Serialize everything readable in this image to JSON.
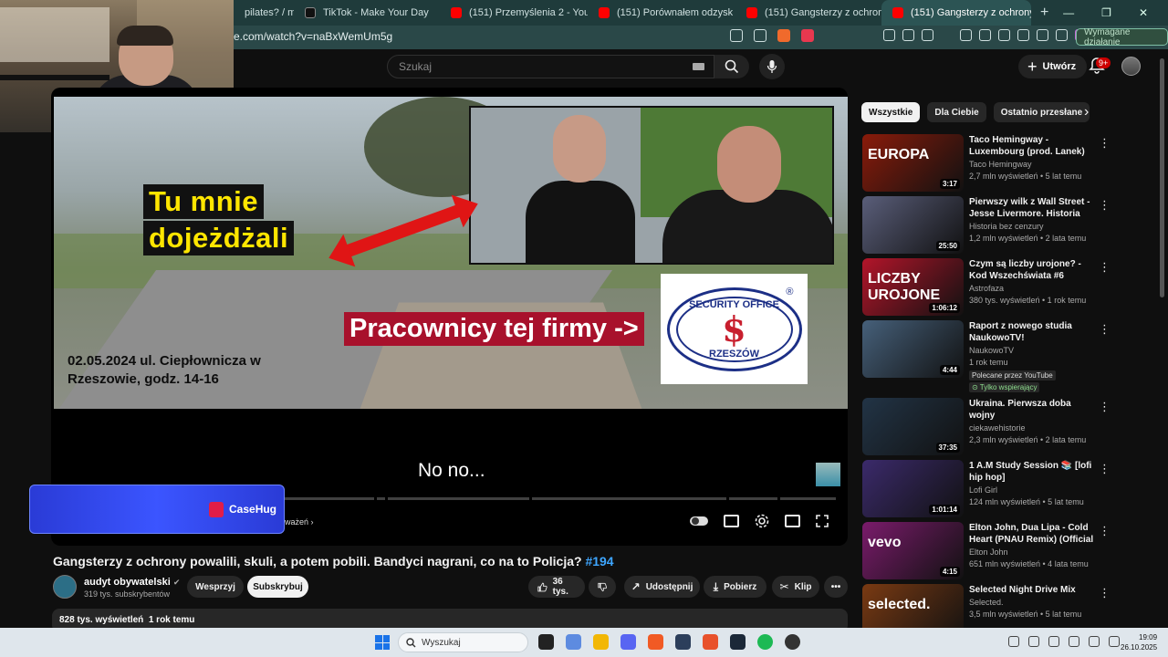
{
  "browser": {
    "tabs": [
      {
        "label": "pilates? / myśl no",
        "active": false,
        "favicon_color": "#ffffff"
      },
      {
        "label": "TikTok - Make Your Day",
        "active": false,
        "favicon_color": "#111111"
      },
      {
        "label": "(151) Przemyślenia 2 - YouTube",
        "active": false,
        "favicon_color": "#ff0000"
      },
      {
        "label": "(151) Porównałem odzysk miedzi. Co",
        "active": false,
        "favicon_color": "#ff0000"
      },
      {
        "label": "(151) Gangsterzy z ochrony powalili,",
        "active": false,
        "favicon_color": "#ff0000"
      },
      {
        "label": "(151) Gangsterzy z ochrony p",
        "active": true,
        "favicon_color": "#ff0000"
      }
    ],
    "new_tab": "+",
    "url": "e.com/watch?v=naBxWemUm5g",
    "action_button": "Wymagane działanie",
    "window_controls": [
      "—",
      "❐",
      "✕"
    ]
  },
  "youtube_header": {
    "search_placeholder": "Szukaj",
    "create_label": "Utwórz",
    "notification_count": "9+"
  },
  "player": {
    "frame_caption_top": "Tu mnie",
    "frame_caption_bottom": "dojeżdżali",
    "frame_caption_red": "Pracownicy tej firmy ->",
    "frame_date_line1": "02.05.2024 ul. Ciepłownicza w",
    "frame_date_line2": "Rzeszowie, godz. 14-16",
    "logo_top": "SECURITY OFFICE",
    "logo_bottom": "RZESZÓW",
    "logo_mark": "$",
    "logo_reg": "®",
    "subtitle": "No no...",
    "chapter_link": "ważeń ›"
  },
  "overlay": {
    "brand": "CaseHug"
  },
  "video": {
    "title": "Gangsterzy z ochrony powalili, skuli, a potem pobili. Bandyci nagrani, co na to Policja?",
    "hashtag": "#194",
    "channel_name": "audyt obywatelski",
    "channel_verified": "✔",
    "channel_subs": "319 tys. subskrybentów",
    "support_label": "Wesprzyj",
    "subscribe_label": "Subskrybuj",
    "like_count": "36 tys.",
    "share_label": "Udostępnij",
    "download_label": "Pobierz",
    "clip_label": "Klip",
    "views": "828 tys. wyświetleń",
    "age": "1 rok temu"
  },
  "sidebar": {
    "chips": [
      "Wszystkie",
      "Dla Ciebie",
      "Ostatnio przesłane"
    ],
    "recommendations": [
      {
        "title": "Taco Hemingway - Luxembourg (prod. Lanek)",
        "channel": "Taco Hemingway",
        "meta": "2,7 mln wyświetleń • 5 lat temu",
        "duration": "3:17",
        "thumb_text": "EUROPA",
        "thumb_color": "#8a1b0a"
      },
      {
        "title": "Pierwszy wilk z Wall Street - Jesse Livermore. Historia Bez ...",
        "channel": "Historia bez cenzury",
        "meta": "1,2 mln wyświetleń • 2 lata temu",
        "duration": "25:50",
        "thumb_text": "",
        "thumb_color": "#5a5e7a"
      },
      {
        "title": "Czym są liczby urojone? - Kod Wszechświata #6",
        "channel": "Astrofaza",
        "meta": "380 tys. wyświetleń • 1 rok temu",
        "duration": "1:06:12",
        "thumb_text": "LICZBY UROJONE",
        "thumb_color": "#b3152a"
      },
      {
        "title": "Raport z nowego studia NaukowoTV!",
        "channel": "NaukowoTV",
        "meta": "1 rok temu",
        "duration": "4:44",
        "thumb_text": "",
        "thumb_color": "#46607a",
        "badge_recommended": "Polecane przez YouTube",
        "badge_supporting": "⊙ Tylko wspierający"
      },
      {
        "title": "Ukraina. Pierwsza doba wojny",
        "channel": "ciekawehistorie",
        "meta": "2,3 mln wyświetleń • 2 lata temu",
        "duration": "37:35",
        "thumb_text": "",
        "thumb_color": "#223446"
      },
      {
        "title": "1 A.M Study Session 📚 [lofi hip hop]",
        "channel": "Lofi Girl",
        "meta": "124 mln wyświetleń • 5 lat temu",
        "duration": "1:01:14",
        "thumb_text": "",
        "thumb_color": "#3b2a6b"
      },
      {
        "title": "Elton John, Dua Lipa - Cold Heart (PNAU Remix) (Official ...",
        "channel": "Elton John",
        "meta": "651 mln wyświetleń • 4 lata temu",
        "duration": "4:15",
        "thumb_text": "vevo",
        "thumb_color": "#7a1b6b"
      },
      {
        "title": "Selected Night Drive Mix",
        "channel": "Selected.",
        "meta": "3,5 mln wyświetleń • 5 lat temu",
        "duration": "",
        "thumb_text": "selected.",
        "thumb_color": "#7a3a12"
      }
    ]
  },
  "taskbar": {
    "search_placeholder": "Wyszukaj",
    "time": "19:09",
    "date": "26.10.2025"
  }
}
